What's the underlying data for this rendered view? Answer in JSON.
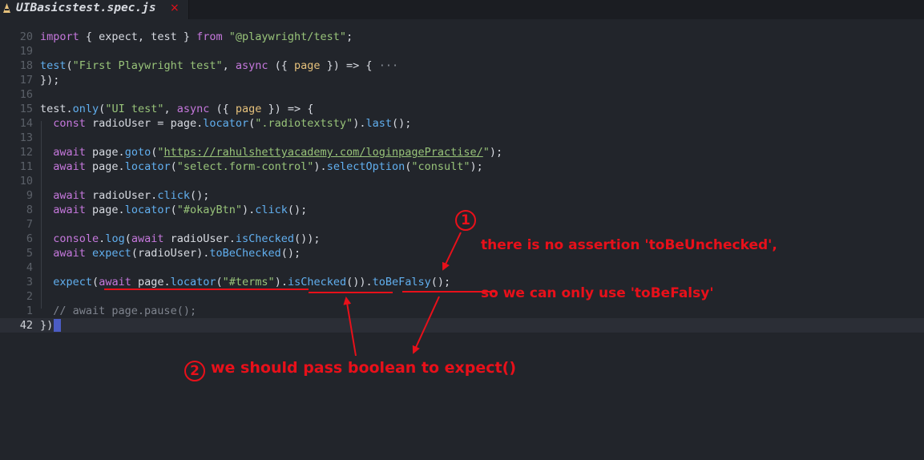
{
  "tab": {
    "icon": "javascript-file-icon",
    "title": "UIBasicstest.spec.js",
    "close": "×"
  },
  "colors": {
    "background": "#22252b",
    "keyword": "#c678dd",
    "string": "#98c379",
    "function": "#61afef",
    "comment": "#7f848e",
    "annotation": "#e8101a"
  },
  "lines": [
    {
      "num": "20",
      "tokens": [
        [
          "import",
          "kw"
        ],
        [
          " { expect, test } ",
          "p"
        ],
        [
          "from",
          "kw"
        ],
        [
          " ",
          "p"
        ],
        [
          "\"@playwright/test\"",
          "str"
        ],
        [
          ";",
          "p"
        ]
      ]
    },
    {
      "num": "19",
      "tokens": []
    },
    {
      "num": "18",
      "tokens": [
        [
          "test",
          "fn"
        ],
        [
          "(",
          "p"
        ],
        [
          "\"First Playwright test\"",
          "str"
        ],
        [
          ", ",
          "p"
        ],
        [
          "async",
          "kw"
        ],
        [
          " ({ ",
          "p"
        ],
        [
          "page",
          "param"
        ],
        [
          " }) => { ",
          "p"
        ],
        [
          "···",
          "fold"
        ]
      ]
    },
    {
      "num": "17",
      "tokens": [
        [
          "});",
          "p"
        ]
      ]
    },
    {
      "num": "16",
      "tokens": []
    },
    {
      "num": "15",
      "tokens": [
        [
          "test",
          "p"
        ],
        [
          ".",
          "p"
        ],
        [
          "only",
          "fn"
        ],
        [
          "(",
          "p"
        ],
        [
          "\"UI test\"",
          "str"
        ],
        [
          ", ",
          "p"
        ],
        [
          "async",
          "kw"
        ],
        [
          " ({ ",
          "p"
        ],
        [
          "page",
          "param"
        ],
        [
          " }) => {",
          "p"
        ]
      ]
    },
    {
      "num": "14",
      "tokens": [
        [
          "  ",
          "p"
        ],
        [
          "const",
          "kw"
        ],
        [
          " radioUser = page.",
          "p"
        ],
        [
          "locator",
          "fn"
        ],
        [
          "(",
          "p"
        ],
        [
          "\".radiotextsty\"",
          "str"
        ],
        [
          ").",
          "p"
        ],
        [
          "last",
          "fn"
        ],
        [
          "();",
          "p"
        ]
      ]
    },
    {
      "num": "13",
      "tokens": []
    },
    {
      "num": "12",
      "tokens": [
        [
          "  ",
          "p"
        ],
        [
          "await",
          "kw"
        ],
        [
          " page.",
          "p"
        ],
        [
          "goto",
          "fn"
        ],
        [
          "(",
          "p"
        ],
        [
          "\"",
          "str"
        ],
        [
          "https://rahulshettyacademy.com/loginpagePractise/",
          "url"
        ],
        [
          "\"",
          "str"
        ],
        [
          ");",
          "p"
        ]
      ]
    },
    {
      "num": "11",
      "tokens": [
        [
          "  ",
          "p"
        ],
        [
          "await",
          "kw"
        ],
        [
          " page.",
          "p"
        ],
        [
          "locator",
          "fn"
        ],
        [
          "(",
          "p"
        ],
        [
          "\"select.form-control\"",
          "str"
        ],
        [
          ").",
          "p"
        ],
        [
          "selectOption",
          "fn"
        ],
        [
          "(",
          "p"
        ],
        [
          "\"consult\"",
          "str"
        ],
        [
          ");",
          "p"
        ]
      ]
    },
    {
      "num": "10",
      "tokens": []
    },
    {
      "num": "9",
      "tokens": [
        [
          "  ",
          "p"
        ],
        [
          "await",
          "kw"
        ],
        [
          " radioUser.",
          "p"
        ],
        [
          "click",
          "fn"
        ],
        [
          "();",
          "p"
        ]
      ]
    },
    {
      "num": "8",
      "tokens": [
        [
          "  ",
          "p"
        ],
        [
          "await",
          "kw"
        ],
        [
          " page.",
          "p"
        ],
        [
          "locator",
          "fn"
        ],
        [
          "(",
          "p"
        ],
        [
          "\"#okayBtn\"",
          "str"
        ],
        [
          ").",
          "p"
        ],
        [
          "click",
          "fn"
        ],
        [
          "();",
          "p"
        ]
      ]
    },
    {
      "num": "7",
      "tokens": []
    },
    {
      "num": "6",
      "tokens": [
        [
          "  ",
          "p"
        ],
        [
          "console",
          "kw"
        ],
        [
          ".",
          "p"
        ],
        [
          "log",
          "fn"
        ],
        [
          "(",
          "p"
        ],
        [
          "await",
          "kw"
        ],
        [
          " radioUser.",
          "p"
        ],
        [
          "isChecked",
          "fn"
        ],
        [
          "());",
          "p"
        ]
      ]
    },
    {
      "num": "5",
      "tokens": [
        [
          "  ",
          "p"
        ],
        [
          "await",
          "kw"
        ],
        [
          " ",
          "p"
        ],
        [
          "expect",
          "fn"
        ],
        [
          "(radioUser).",
          "p"
        ],
        [
          "toBeChecked",
          "fn"
        ],
        [
          "();",
          "p"
        ]
      ]
    },
    {
      "num": "4",
      "tokens": []
    },
    {
      "num": "3",
      "tokens": [
        [
          "  ",
          "p"
        ],
        [
          "expect",
          "fn"
        ],
        [
          "(",
          "p"
        ],
        [
          "await",
          "kw"
        ],
        [
          " page.",
          "p"
        ],
        [
          "locator",
          "fn"
        ],
        [
          "(",
          "p"
        ],
        [
          "\"#terms\"",
          "str"
        ],
        [
          ").",
          "p"
        ],
        [
          "isChecked",
          "fn"
        ],
        [
          "()).",
          "p"
        ],
        [
          "toBeFalsy",
          "fn"
        ],
        [
          "();",
          "p"
        ]
      ]
    },
    {
      "num": "2",
      "tokens": []
    },
    {
      "num": "1",
      "tokens": [
        [
          "  ",
          "p"
        ],
        [
          "// await page.pause();",
          "cm"
        ]
      ]
    },
    {
      "num": "42",
      "tokens": [
        [
          "})",
          "p"
        ],
        [
          ";",
          "p"
        ]
      ],
      "current": true
    }
  ],
  "annotations": {
    "note1_number": "1",
    "note1_line1": "there is no assertion 'toBeUnchecked',",
    "note1_line2": "so we can only use 'toBeFalsy'",
    "note2_number": "2",
    "note2_text": "we should pass boolean to expect()"
  }
}
